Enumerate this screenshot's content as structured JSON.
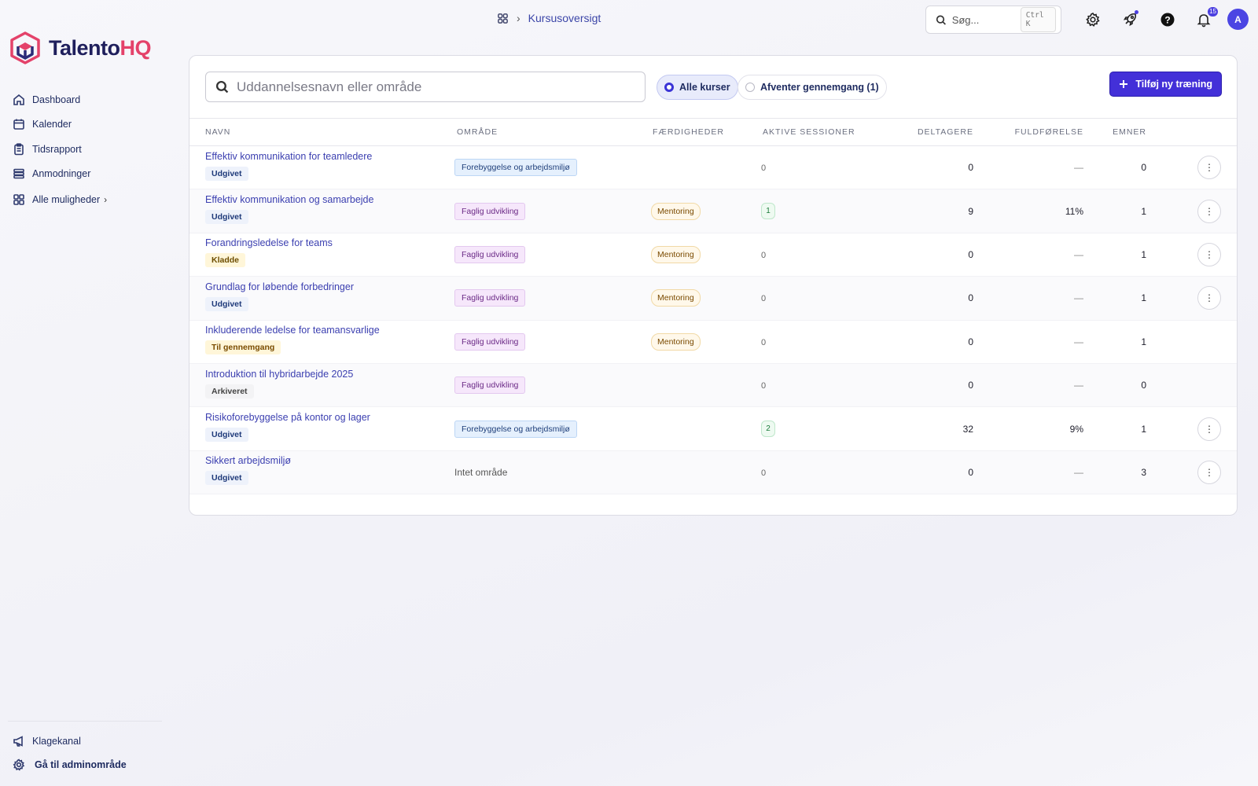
{
  "brand": {
    "name_main": "Talento",
    "name_accent": "HQ",
    "accent_color": "#e4426a",
    "primary_color": "#4330d8"
  },
  "sidebar": {
    "items": [
      {
        "label": "Dashboard",
        "icon": "home-icon"
      },
      {
        "label": "Kalender",
        "icon": "calendar-icon"
      },
      {
        "label": "Tidsrapport",
        "icon": "clipboard-icon"
      },
      {
        "label": "Anmodninger",
        "icon": "stack-icon"
      }
    ],
    "more": {
      "label": "Alle muligheder",
      "icon": "grid-icon"
    },
    "bottom": [
      {
        "label": "Klagekanal",
        "icon": "megaphone-icon"
      },
      {
        "label": "Gå til adminområde",
        "icon": "gear-icon"
      }
    ]
  },
  "topbar": {
    "breadcrumb": "Kursusoversigt",
    "search_placeholder": "Søg...",
    "search_shortcut": "Ctrl K",
    "notification_count": "15",
    "avatar_initial": "A"
  },
  "filters": {
    "search_placeholder": "Uddannelsesnavn eller område",
    "all_label": "Alle kurser",
    "pending_label": "Afventer gennemgang (1)",
    "add_button": "Tilføj ny træning"
  },
  "table": {
    "headers": [
      "Navn",
      "Område",
      "Færdigheder",
      "Aktive sessioner",
      "Deltagere",
      "Fuldførelse",
      "Emner"
    ],
    "rows": [
      {
        "name": "Effektiv kommunikation for teamledere",
        "status": "Udgivet",
        "area": "Forebyggelse og arbejdsmiljø",
        "skill": "",
        "sessions": "0",
        "participants": "0",
        "completion": "—",
        "topics": "0",
        "menu": true
      },
      {
        "name": "Effektiv kommunikation og samarbejde",
        "status": "Udgivet",
        "area": "Faglig udvikling",
        "skill": "Mentoring",
        "sessions": "1",
        "participants": "9",
        "completion": "11%",
        "topics": "1",
        "menu": true
      },
      {
        "name": "Forandringsledelse for teams",
        "status": "Kladde",
        "area": "Faglig udvikling",
        "skill": "Mentoring",
        "sessions": "0",
        "participants": "0",
        "completion": "—",
        "topics": "1",
        "menu": true
      },
      {
        "name": "Grundlag for løbende forbedringer",
        "status": "Udgivet",
        "area": "Faglig udvikling",
        "skill": "Mentoring",
        "sessions": "0",
        "participants": "0",
        "completion": "—",
        "topics": "1",
        "menu": true
      },
      {
        "name": "Inkluderende ledelse for teamansvarlige",
        "status": "Til gennemgang",
        "area": "Faglig udvikling",
        "skill": "Mentoring",
        "sessions": "0",
        "participants": "0",
        "completion": "—",
        "topics": "1",
        "menu": false
      },
      {
        "name": "Introduktion til hybridarbejde 2025",
        "status": "Arkiveret",
        "area": "Faglig udvikling",
        "skill": "",
        "sessions": "0",
        "participants": "0",
        "completion": "—",
        "topics": "0",
        "menu": false
      },
      {
        "name": "Risikoforebyggelse på kontor og lager",
        "status": "Udgivet",
        "area": "Forebyggelse og arbejdsmiljø",
        "skill": "",
        "sessions": "2",
        "participants": "32",
        "completion": "9%",
        "topics": "1",
        "menu": true
      },
      {
        "name": "Sikkert arbejdsmiljø",
        "status": "Udgivet",
        "area": "Intet område",
        "skill": "",
        "sessions": "0",
        "participants": "0",
        "completion": "—",
        "topics": "3",
        "menu": true
      }
    ]
  }
}
